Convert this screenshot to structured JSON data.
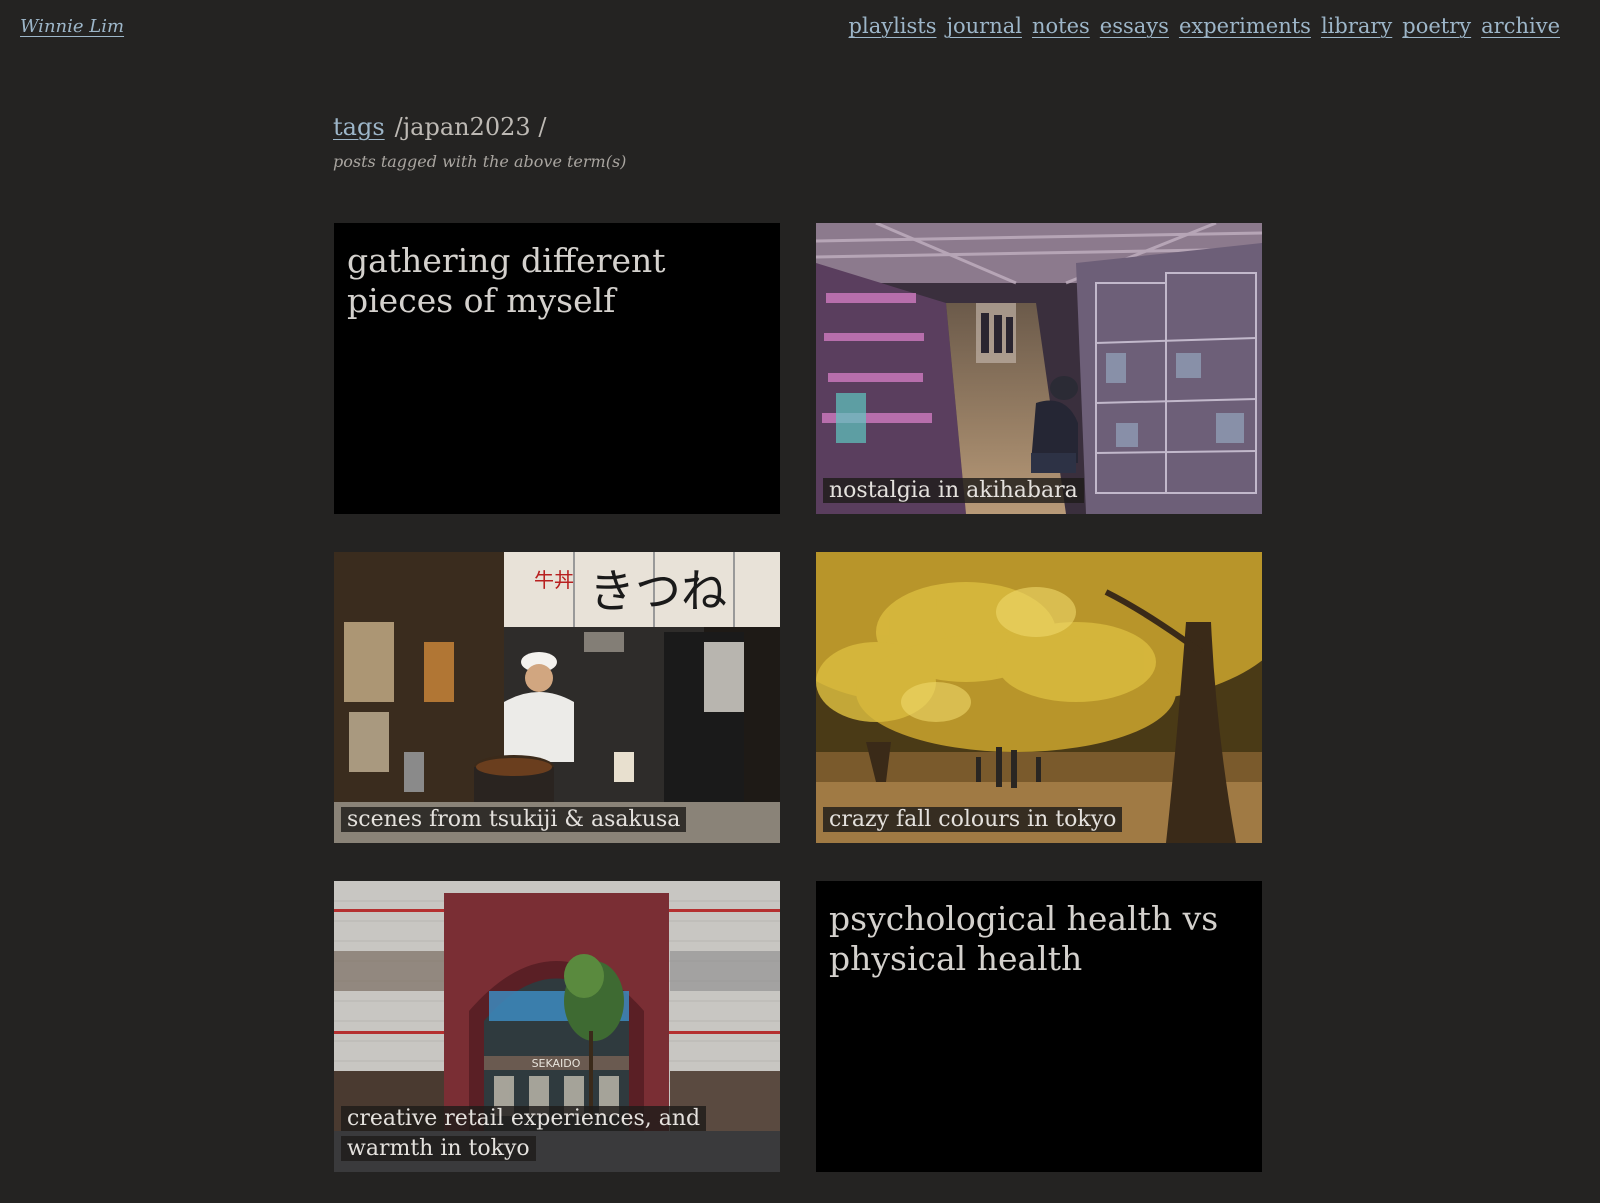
{
  "site": {
    "name": "Winnie Lim"
  },
  "nav": {
    "items": [
      {
        "label": "playlists"
      },
      {
        "label": "journal"
      },
      {
        "label": "notes"
      },
      {
        "label": "essays"
      },
      {
        "label": "experiments"
      },
      {
        "label": "library"
      },
      {
        "label": "poetry"
      },
      {
        "label": "archive"
      }
    ]
  },
  "breadcrumb": {
    "root": "tags",
    "term": "/japan2023 /"
  },
  "page": {
    "subtitle": "posts tagged with the above term(s)"
  },
  "posts": [
    {
      "title": "gathering different pieces of myself",
      "has_image": false
    },
    {
      "title": "nostalgia in akihabara",
      "has_image": true,
      "image": "akihabara-shop-photo"
    },
    {
      "title": "scenes from tsukiji & asakusa",
      "has_image": true,
      "image": "food-stall-chef-photo"
    },
    {
      "title": "crazy fall colours in tokyo",
      "has_image": true,
      "image": "ginkgo-trees-photo"
    },
    {
      "title": "creative retail experiences, and warmth in tokyo",
      "has_image": true,
      "image": "storefront-arch-photo"
    },
    {
      "title": "psychological health vs physical health",
      "has_image": false
    }
  ],
  "photo_signs": {
    "sekaido": "SEKAIDO",
    "gyudon": "牛丼",
    "noren": "きつね"
  }
}
